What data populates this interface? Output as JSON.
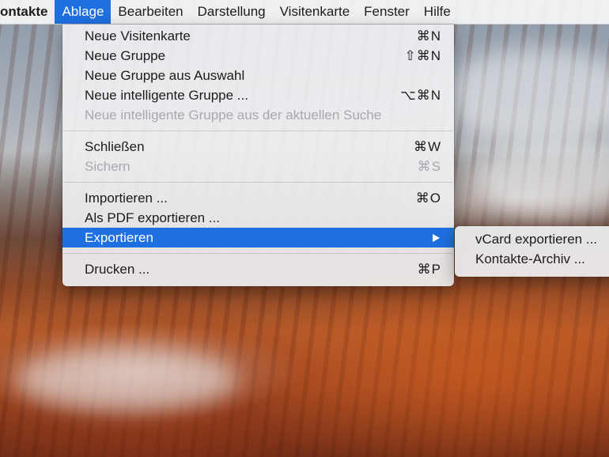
{
  "menubar": {
    "app_name": "ontakte",
    "items": [
      "Ablage",
      "Bearbeiten",
      "Darstellung",
      "Visitenkarte",
      "Fenster",
      "Hilfe"
    ],
    "active_item": "Ablage"
  },
  "file_menu": {
    "group1": [
      {
        "label": "Neue Visitenkarte",
        "shortcut": "⌘N"
      },
      {
        "label": "Neue Gruppe",
        "shortcut": "⇧⌘N"
      },
      {
        "label": "Neue Gruppe aus Auswahl",
        "shortcut": ""
      },
      {
        "label": "Neue intelligente Gruppe ...",
        "shortcut": "⌥⌘N"
      },
      {
        "label": "Neue intelligente Gruppe aus der aktuellen Suche",
        "shortcut": "",
        "disabled": true
      }
    ],
    "group2": [
      {
        "label": "Schließen",
        "shortcut": "⌘W"
      },
      {
        "label": "Sichern",
        "shortcut": "⌘S",
        "disabled": true
      }
    ],
    "group3": [
      {
        "label": "Importieren ...",
        "shortcut": "⌘O"
      },
      {
        "label": "Als PDF exportieren ...",
        "shortcut": ""
      },
      {
        "label": "Exportieren",
        "shortcut": "",
        "highlighted": true,
        "has_submenu": true
      }
    ],
    "group4": [
      {
        "label": "Drucken ...",
        "shortcut": "⌘P"
      }
    ]
  },
  "export_submenu": {
    "items": [
      {
        "label": "vCard exportieren ..."
      },
      {
        "label": "Kontakte-Archiv ..."
      }
    ]
  },
  "colors": {
    "highlight": "#1e6fe0",
    "disabled_text": "#a9a9ad"
  }
}
